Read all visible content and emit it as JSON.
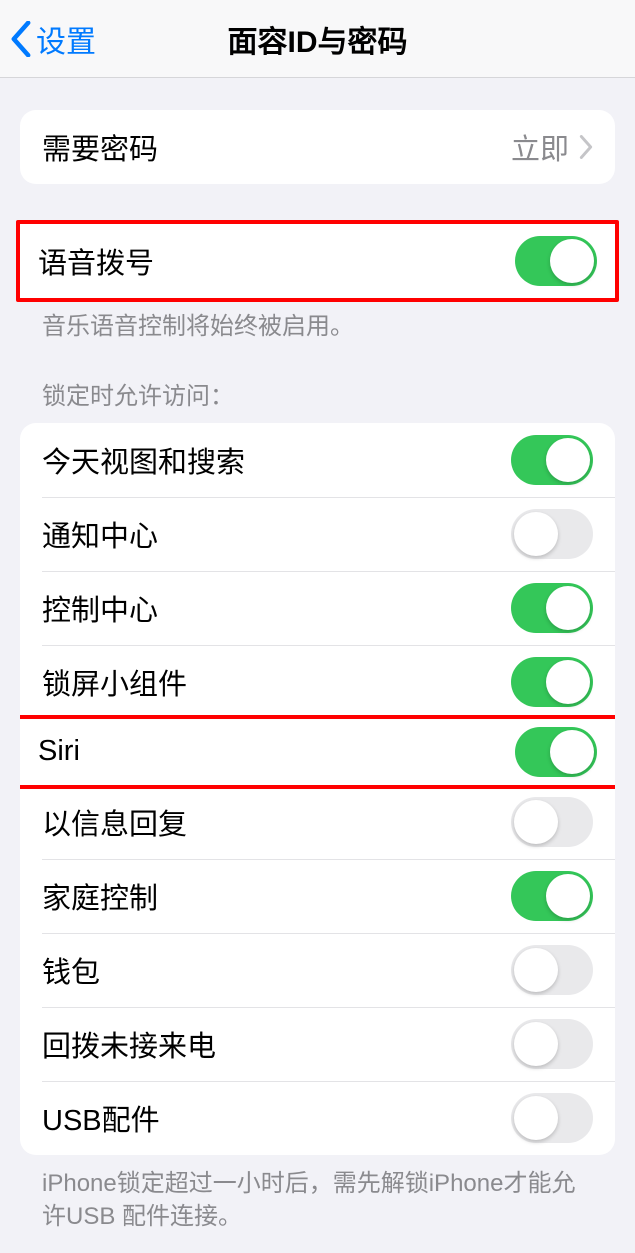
{
  "nav": {
    "back_label": "设置",
    "title": "面容ID与密码"
  },
  "passcode_group": {
    "require_passcode_label": "需要密码",
    "require_passcode_value": "立即"
  },
  "voice_dial": {
    "label": "语音拨号",
    "on": true,
    "footer": "音乐语音控制将始终被启用。"
  },
  "lock_access": {
    "header": "锁定时允许访问：",
    "items": [
      {
        "label": "今天视图和搜索",
        "on": true,
        "highlight": false
      },
      {
        "label": "通知中心",
        "on": false,
        "highlight": false
      },
      {
        "label": "控制中心",
        "on": true,
        "highlight": false
      },
      {
        "label": "锁屏小组件",
        "on": true,
        "highlight": false
      },
      {
        "label": "Siri",
        "on": true,
        "highlight": true
      },
      {
        "label": "以信息回复",
        "on": false,
        "highlight": false
      },
      {
        "label": "家庭控制",
        "on": true,
        "highlight": false
      },
      {
        "label": "钱包",
        "on": false,
        "highlight": false
      },
      {
        "label": "回拨未接来电",
        "on": false,
        "highlight": false
      },
      {
        "label": "USB配件",
        "on": false,
        "highlight": false
      }
    ],
    "footer": "iPhone锁定超过一小时后，需先解锁iPhone才能允许USB 配件连接。"
  },
  "colors": {
    "accent": "#007aff",
    "toggle_on": "#34c759",
    "toggle_off": "#e9e9eb",
    "highlight": "#ff0000"
  }
}
